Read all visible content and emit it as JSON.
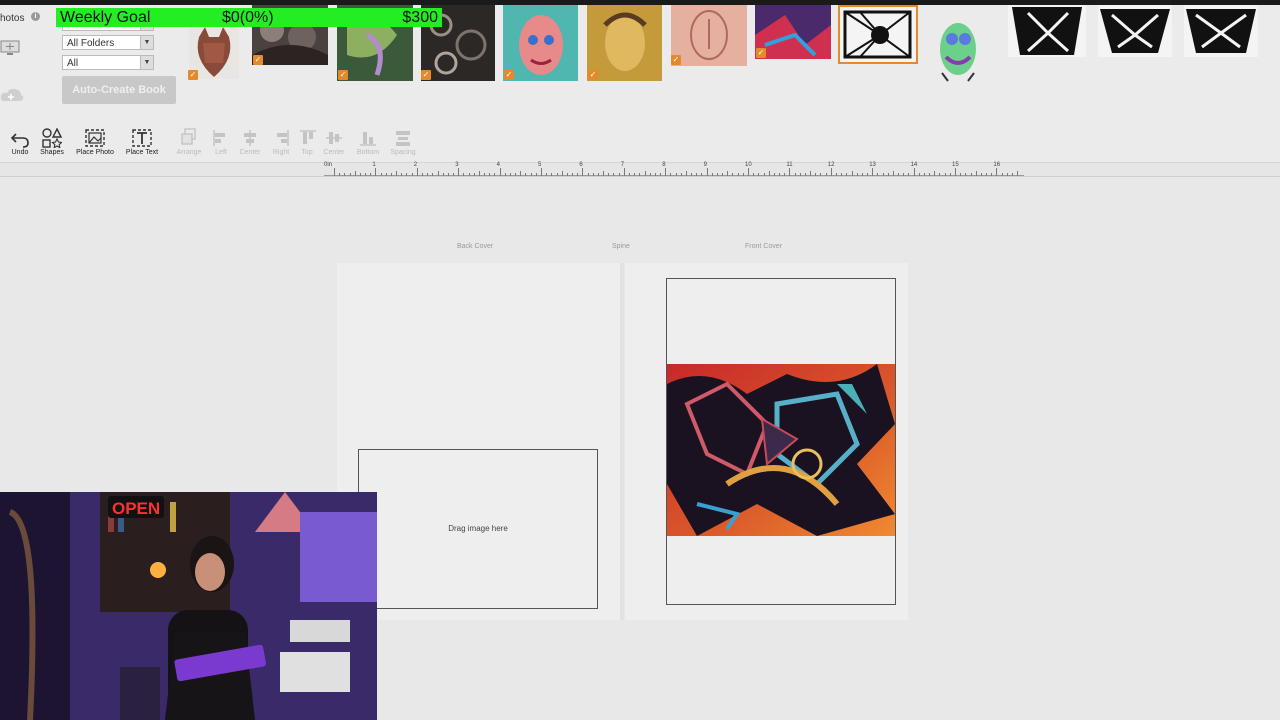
{
  "photos_panel": {
    "label": "hotos",
    "info_icon": "info-icon",
    "folder_filter": "All Folders",
    "type_filter": "All",
    "auto_create_label": "Auto-Create Book",
    "thumbnails": [
      {
        "name": "fox-painting",
        "checked": true
      },
      {
        "name": "grey-abstract",
        "checked": true
      },
      {
        "name": "green-abstract",
        "checked": true
      },
      {
        "name": "swirl-abstract",
        "checked": true
      },
      {
        "name": "colorful-face",
        "checked": true
      },
      {
        "name": "yellow-portrait",
        "checked": true
      },
      {
        "name": "pink-face",
        "checked": true
      },
      {
        "name": "purple-abstract",
        "checked": true
      },
      {
        "name": "black-white-geometric",
        "checked": false
      },
      {
        "name": "green-creature",
        "checked": false
      },
      {
        "name": "geometric-mask-1",
        "checked": false
      },
      {
        "name": "geometric-mask-2",
        "checked": false
      },
      {
        "name": "geometric-mask-3",
        "checked": false
      }
    ]
  },
  "weekly_goal": {
    "label": "Weekly Goal",
    "current": "$0(0%)",
    "target": "$300"
  },
  "toolbar": {
    "undo": "Undo",
    "shapes": "Shapes",
    "place_photo": "Place Photo",
    "place_text": "Place Text",
    "arrange": "Arrange",
    "left": "Left",
    "center": "Center",
    "right": "Right",
    "top": "Top",
    "center_v": "Center",
    "bottom": "Bottom",
    "spacing": "Spacing"
  },
  "ruler": {
    "origin": "0in",
    "marks": [
      "1",
      "2",
      "3",
      "4",
      "5",
      "6",
      "7",
      "8",
      "9",
      "10",
      "11",
      "12",
      "13",
      "14",
      "15",
      "16"
    ]
  },
  "cover": {
    "back_label": "Back Cover",
    "spine_label": "Spine",
    "front_label": "Front Cover",
    "drop_text": "Drag image here"
  },
  "colors": {
    "goal_bar": "#22ee22",
    "checkbox": "#e58a2a",
    "selected_border": "#e58a2a"
  }
}
